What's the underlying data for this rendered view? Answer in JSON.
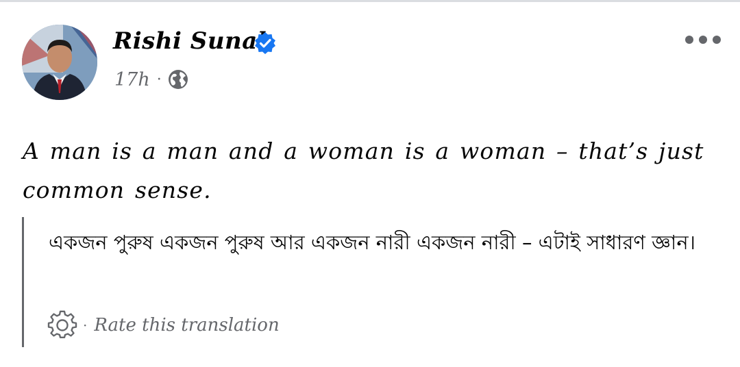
{
  "post": {
    "author": "Rishi Sunak",
    "verified": true,
    "timestamp": "17h",
    "separator": "·",
    "audience_icon": "globe-icon",
    "more_icon": "more-options-icon",
    "text": "A man is a man and a woman is a woman – that’s just common sense."
  },
  "translation": {
    "text": "একজন পুরুষ একজন পুরুষ আর একজন নারী একজন নারী – এটাই সাধারণ জ্ঞান।",
    "rate_icon": "gear-icon",
    "rate_label": "Rate this translation"
  },
  "colors": {
    "verified_blue": "#1877f2",
    "secondary_text": "#65676b",
    "primary_text": "#050505"
  }
}
